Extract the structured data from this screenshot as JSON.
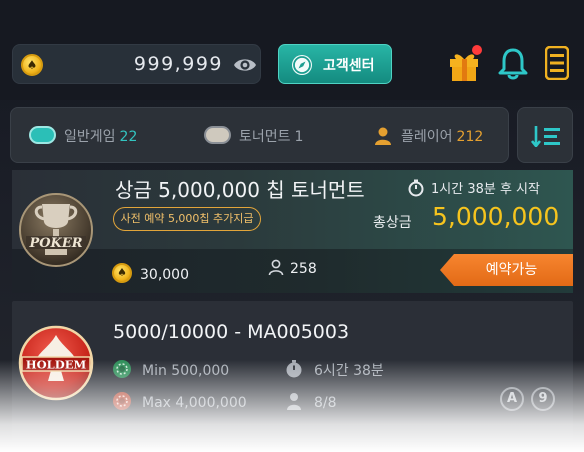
{
  "header": {
    "balance": "999,999",
    "support_label": "고객센터"
  },
  "filters": {
    "tabs": [
      {
        "label": "일반게임",
        "count": "22",
        "count_color": "#33c4c0"
      },
      {
        "label": "토너먼트",
        "count": "1",
        "count_color": "#9ba2ab"
      },
      {
        "label": "플레이어",
        "count": "212",
        "count_color": "#e5a030"
      }
    ]
  },
  "tournament": {
    "title": "상금 5,000,000 칩 토너먼트",
    "start_time": "1시간 38분 후 시작",
    "reserve_badge": "사전 예약 5,000칩 추가지급",
    "prize_label": "총상금",
    "prize_value": "5,000,000",
    "buyin": "30,000",
    "players": "258",
    "reserve_button": "예약가능",
    "logo_text": "POKER"
  },
  "holdem_table": {
    "title": "5000/10000 - MA005003",
    "min": "Min 500,000",
    "max": "Max 4,000,000",
    "time": "6시간 38분",
    "seats": "8/8",
    "badge_a": "A",
    "badge_num": "9",
    "logo_text": "HOLDEM"
  },
  "colors": {
    "accent_teal": "#1fa597",
    "prize_gold": "#f6c41e",
    "reserve_orange": "#f07a22",
    "notification_red": "#ff3b3b"
  }
}
